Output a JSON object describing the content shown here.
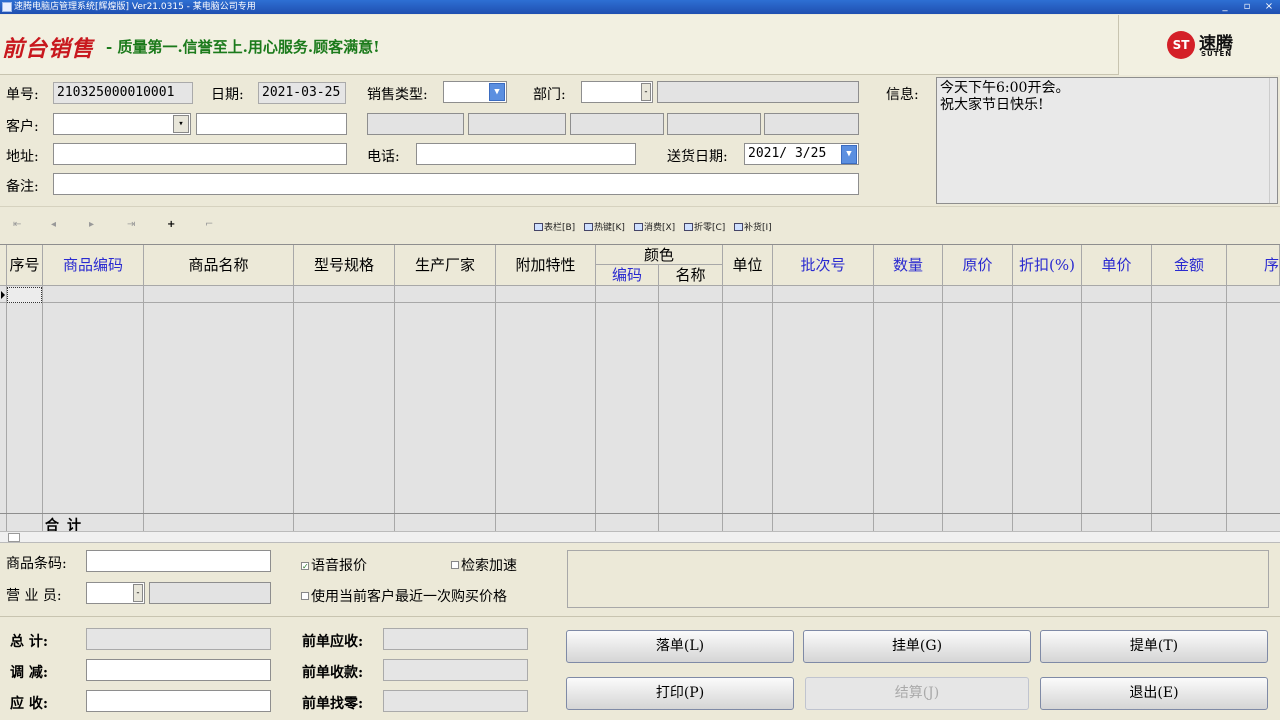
{
  "window": {
    "title": "速腾电脑店管理系统[辉煌版] Ver21.0315  -  某电脑公司专用",
    "min": "_",
    "max": "▫",
    "close": "×"
  },
  "banner": {
    "brand": "前台销售",
    "slogan": "- 质量第一.信誉至上.用心服务.顾客满意!",
    "logo_mark": "ST",
    "logo_cn": "速腾",
    "logo_en": "SUTEN"
  },
  "form": {
    "order_no_label": "单号:",
    "order_no": "210325000010001",
    "date_label": "日期:",
    "date": "2021-03-25",
    "sale_type_label": "销售类型:",
    "sale_type": "",
    "dept_label": "部门:",
    "dept": "",
    "info_label": "信息:",
    "customer_label": "客户:",
    "customer": "",
    "address_label": "地址:",
    "address": "",
    "phone_label": "电话:",
    "phone": "",
    "delivery_label": "送货日期:",
    "delivery_date": "2021/ 3/25",
    "note_label": "备注:",
    "note": "",
    "info_lines": [
      "今天下午6:00开会。",
      "祝大家节日快乐!"
    ]
  },
  "toolbar": {
    "nav": [
      "⇤",
      "◂",
      "▸",
      "⇥",
      "+",
      "⌐"
    ],
    "buttons": [
      "表栏[B]",
      "热键[K]",
      "消费[X]",
      "折零[C]",
      "补货[I]"
    ]
  },
  "grid": {
    "headers": [
      "序号",
      "商品编码",
      "商品名称",
      "型号规格",
      "生产厂家",
      "附加特性",
      "颜色",
      "单位",
      "批次号",
      "数量",
      "原价",
      "折扣(%)",
      "单价",
      "金额",
      "序"
    ],
    "color_sub": [
      "编码",
      "名称"
    ],
    "total_label": "合计"
  },
  "bottom": {
    "barcode_label": "商品条码:",
    "barcode": "",
    "clerk_label": "营 业 员:",
    "clerk": "",
    "voice_price": "语音报价",
    "voice_checked": true,
    "fast_search": "检索加速",
    "fast_checked": false,
    "last_price": "使用当前客户最近一次购买价格",
    "last_checked": false,
    "total_label": "总    计:",
    "adjust_label": "调    减:",
    "receivable_label": "应    收:",
    "prev_receivable_label": "前单应收:",
    "prev_received_label": "前单收款:",
    "prev_change_label": "前单找零:",
    "total": "",
    "adjust": "",
    "receivable": ""
  },
  "buttons": {
    "post": "落单(L)",
    "hold": "挂单(G)",
    "retrieve": "提单(T)",
    "print": "打印(P)",
    "settle": "结算(J)",
    "exit": "退出(E)"
  }
}
